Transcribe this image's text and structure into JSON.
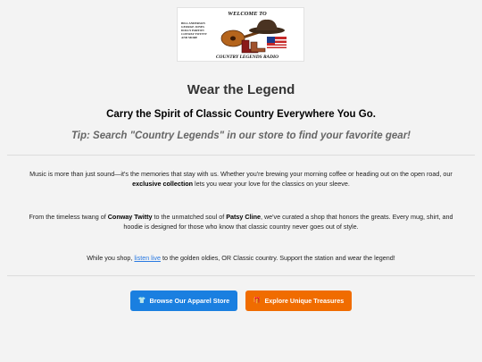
{
  "logo": {
    "top_text": "WELCOME TO",
    "bottom_text": "COUNTRY LEGENDS RADIO",
    "side_text": "BILL ANDERSON GEORGE JONES DOLLY PARTON CONWAY TWITTY"
  },
  "hero": {
    "title": "Wear the Legend",
    "subtitle": "Carry the Spirit of Classic Country Everywhere You Go.",
    "tip": "Tip: Search \"Country Legends\" in our store to find your favorite gear!"
  },
  "para1": {
    "t1": "Music is more than just sound—it's the memories that stay with us. Whether you're brewing your morning coffee or heading out on the open road, our ",
    "bold": "exclusive collection",
    "t2": " lets you wear your love for the classics on your sleeve."
  },
  "para2": {
    "t1": "From the timeless twang of ",
    "artist1": "Conway Twitty",
    "t2": " to the unmatched soul of ",
    "artist2": "Patsy Cline",
    "t3": ", we've curated a shop that honors the greats. Every mug, shirt, and hoodie is designed for those who know that classic country never goes out of style."
  },
  "para3": {
    "t1": "While you shop, ",
    "link": "listen live",
    "t2": " to the golden oldies, OR Classic country. Support the station and wear the legend!"
  },
  "buttons": {
    "apparel_icon": "shirt-icon",
    "apparel_label": "Browse Our Apparel Store",
    "treasures_icon": "gift-icon",
    "treasures_label": "Explore Unique Treasures"
  },
  "colors": {
    "background": "#f3f3f3",
    "apparel_button": "#1a7fe0",
    "treasures_button": "#f06c00",
    "link": "#2a7ae2"
  }
}
